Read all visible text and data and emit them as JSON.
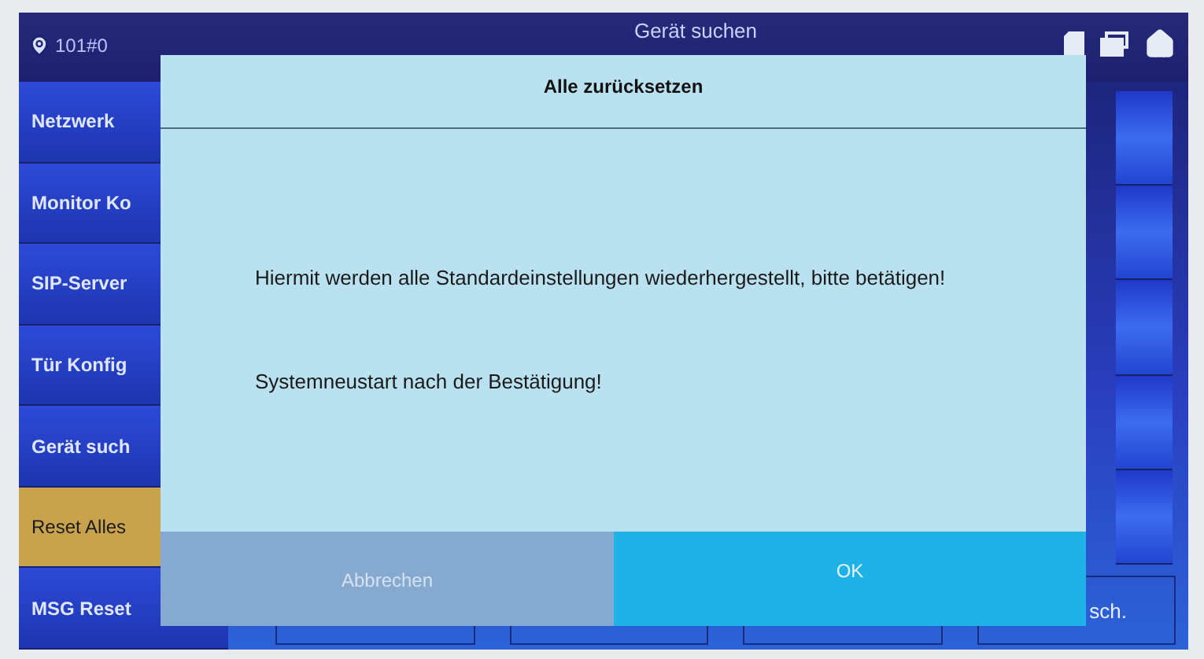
{
  "header": {
    "location": "101#0",
    "title": "Gerät suchen"
  },
  "sidebar": {
    "items": [
      {
        "label": "Netzwerk",
        "selected": false
      },
      {
        "label": "Monitor Ko",
        "selected": false
      },
      {
        "label": "SIP-Server",
        "selected": false
      },
      {
        "label": "Tür Konfig",
        "selected": false
      },
      {
        "label": "Gerät such",
        "selected": false
      },
      {
        "label": "Reset Alles",
        "selected": true
      },
      {
        "label": "MSG Reset",
        "selected": false
      }
    ]
  },
  "bottom_buttons": [
    {
      "label": "sch."
    }
  ],
  "dialog": {
    "title": "Alle zurücksetzen",
    "messages": [
      "Hiermit werden alle Standardeinstellungen wiederhergestellt, bitte betätigen!",
      "Systemneustart nach der Bestätigung!"
    ],
    "buttons": [
      {
        "label": "Abbrechen",
        "kind": "cancel"
      },
      {
        "label": "OK",
        "kind": "confirm"
      }
    ]
  }
}
